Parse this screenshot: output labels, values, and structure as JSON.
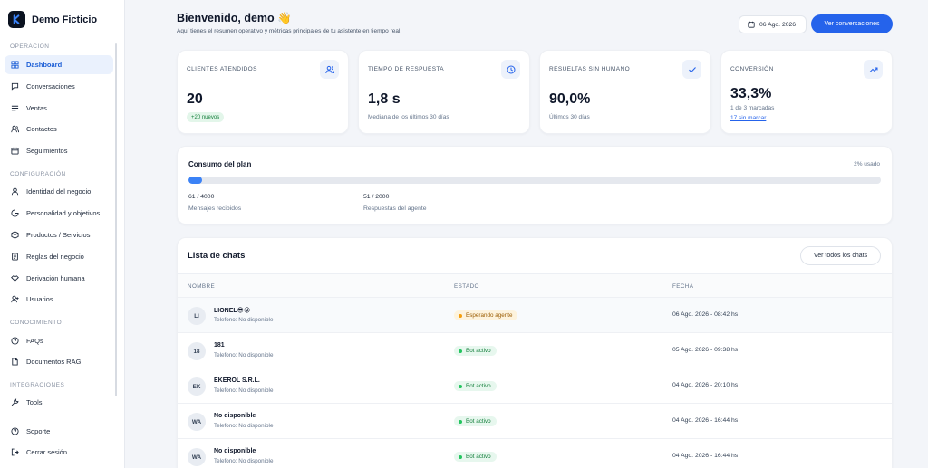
{
  "brand": {
    "name": "Demo Ficticio"
  },
  "sidebar": {
    "sections": {
      "operacion": "Operación",
      "configuracion": "Configuración",
      "conocimiento": "Conocimiento",
      "integraciones": "Integraciones"
    },
    "items": {
      "dashboard": "Dashboard",
      "conversaciones": "Conversaciones",
      "ventas": "Ventas",
      "contactos": "Contactos",
      "seguimientos": "Seguimientos",
      "identidad": "Identidad del negocio",
      "personalidad": "Personalidad y objetivos",
      "productos": "Productos / Servicios",
      "reglas": "Reglas del negocio",
      "derivacion": "Derivación humana",
      "usuarios": "Usuarios",
      "faqs": "FAQs",
      "documentos": "Documentos RAG",
      "tools": "Tools",
      "soporte": "Soporte",
      "cerrar": "Cerrar sesión"
    }
  },
  "header": {
    "title": "Bienvenido, demo 👋",
    "subtitle": "Aquí tienes el resumen operativo y métricas principales de tu asistente en tiempo real.",
    "date": "06 Ago. 2026",
    "cta": "Ver conversaciones"
  },
  "kpis": {
    "clientes": {
      "label": "Clientes atendidos",
      "value": "20",
      "badge": "+20 nuevos"
    },
    "tiempo": {
      "label": "Tiempo de respuesta",
      "value": "1,8 s",
      "note": "Mediana de los últimos 30 días"
    },
    "resueltas": {
      "label": "Resueltas sin humano",
      "value": "90,0%",
      "note": "Últimos 30 días"
    },
    "conversion": {
      "label": "Conversión",
      "value": "33,3%",
      "note": "1 de 3 marcadas",
      "link": "17 sin marcar"
    }
  },
  "plan": {
    "title": "Consumo del plan",
    "usage_text": "2% usado",
    "usage_fraction": 0.02,
    "mensajes": {
      "value": "61 / 4000",
      "label": "Mensajes recibidos"
    },
    "respuestas": {
      "value": "51 / 2000",
      "label": "Respuestas del agente"
    }
  },
  "chats": {
    "title": "Lista de chats",
    "view_all": "Ver todos los chats",
    "columns": {
      "nombre": "Nombre",
      "estado": "Estado",
      "fecha": "Fecha"
    },
    "rows": [
      {
        "initials": "LI",
        "name": "LIONEL😎😜",
        "phone": "Telefono: No disponible",
        "status": "Esperando agente",
        "date": "06 Ago. 2026 - 08:42 hs"
      },
      {
        "initials": "18",
        "name": "181",
        "phone": "Telefono: No disponible",
        "status": "Bot activo",
        "date": "05 Ago. 2026 - 09:38 hs"
      },
      {
        "initials": "EK",
        "name": "EKEROL S.R.L.",
        "phone": "Telefono: No disponible",
        "status": "Bot activo",
        "date": "04 Ago. 2026 - 20:10 hs"
      },
      {
        "initials": "WA",
        "name": "No disponible",
        "phone": "Telefono: No disponible",
        "status": "Bot activo",
        "date": "04 Ago. 2026 - 16:44 hs"
      },
      {
        "initials": "WA",
        "name": "No disponible",
        "phone": "Telefono: No disponible",
        "status": "Bot activo",
        "date": "04 Ago. 2026 - 16:44 hs"
      }
    ]
  },
  "colors": {
    "accent": "#2563eb",
    "active_bg": "#eaf1fd",
    "success": "#22c55e",
    "warning": "#f59e0b"
  },
  "icons": [
    "grid-icon",
    "chat-icon",
    "list-icon",
    "users-icon",
    "calendar-icon",
    "user-icon",
    "pie-icon",
    "box-icon",
    "document-icon",
    "handshake-icon",
    "user-plus-icon",
    "help-icon",
    "file-icon",
    "wrench-icon",
    "logout-icon",
    "trend-up-icon",
    "clock-icon",
    "check-icon"
  ]
}
